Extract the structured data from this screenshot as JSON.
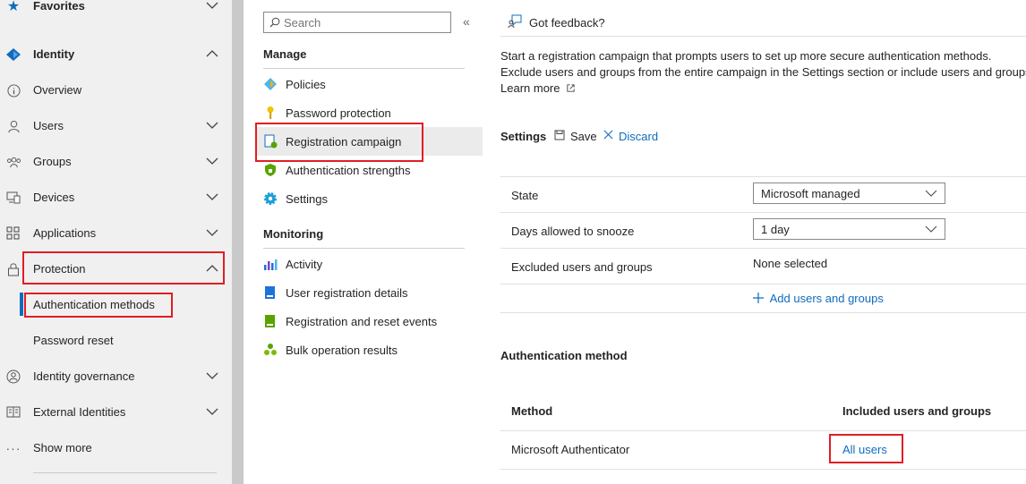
{
  "leftnav": {
    "favorites": "Favorites",
    "identity": "Identity",
    "items": [
      {
        "label": "Overview",
        "icon": "info-icon"
      },
      {
        "label": "Users",
        "icon": "user-icon"
      },
      {
        "label": "Groups",
        "icon": "groups-icon"
      },
      {
        "label": "Devices",
        "icon": "devices-icon"
      },
      {
        "label": "Applications",
        "icon": "applications-icon"
      },
      {
        "label": "Protection",
        "icon": "lock-icon"
      }
    ],
    "protection_sub": [
      "Authentication methods",
      "Password reset"
    ],
    "bottom_items": [
      {
        "label": "Identity governance",
        "icon": "governance-icon"
      },
      {
        "label": "External Identities",
        "icon": "external-identities-icon"
      },
      {
        "label": "Show more",
        "icon": "more-icon"
      }
    ]
  },
  "midmenu": {
    "search_placeholder": "Search",
    "collapse_glyph": "«",
    "manage_header": "Manage",
    "manage_items": [
      "Policies",
      "Password protection",
      "Registration campaign",
      "Authentication strengths",
      "Settings"
    ],
    "monitoring_header": "Monitoring",
    "monitoring_items": [
      "Activity",
      "User registration details",
      "Registration and reset events",
      "Bulk operation results"
    ]
  },
  "content": {
    "feedback": "Got feedback?",
    "description_line1": "Start a registration campaign that prompts users to set up more secure authentication methods.",
    "description_line2": "Exclude users and groups from the entire campaign in the Settings section or include users and groups",
    "learn_more": "Learn more",
    "settings_title": "Settings",
    "save": "Save",
    "discard": "Discard",
    "state_label": "State",
    "state_value": "Microsoft managed",
    "snooze_label": "Days allowed to snooze",
    "snooze_value": "1 day",
    "excluded_label": "Excluded users and groups",
    "excluded_value": "None selected",
    "add_users": "Add users and groups",
    "auth_method_title": "Authentication method",
    "col_method": "Method",
    "col_included": "Included users and groups",
    "method_row": "Microsoft Authenticator",
    "included_row": "All users"
  },
  "colors": {
    "highlight": "#e01e24",
    "link": "#0f6cbd",
    "nav_bg": "#f0f0f0"
  }
}
